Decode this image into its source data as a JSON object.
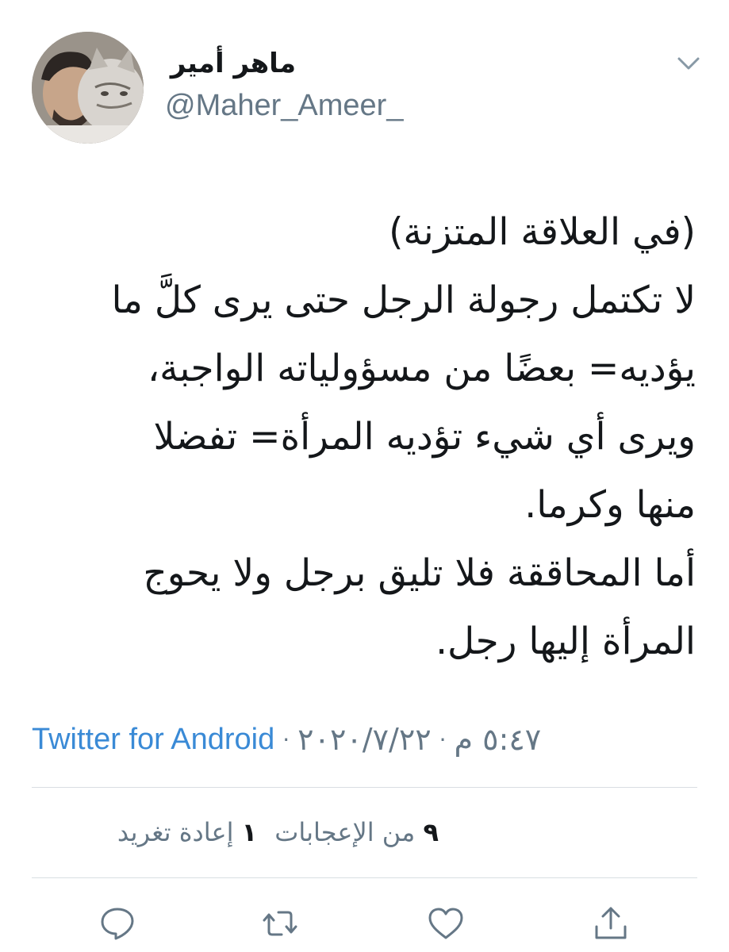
{
  "user": {
    "name": "ماهر أمير",
    "handle": "@Maher_Ameer_"
  },
  "tweet": {
    "lines": [
      "(في العلاقة المتزنة)",
      "لا تكتمل رجولة الرجل حتى يرى كلَّ ما",
      "يؤديه= بعضًا من مسؤولياته الواجبة،",
      "ويرى أي شيء تؤديه المرأة= تفضلا",
      "منها وكرما.",
      "أما المحاققة فلا تليق برجل ولا يحوج",
      "المرأة إليها رجل."
    ]
  },
  "meta": {
    "time": "٥:٤٧ م",
    "date": "٢٠٢٠/٧/٢٢",
    "source": "Twitter for Android",
    "separator": "·"
  },
  "stats": {
    "likes_count": "٩",
    "likes_label": "من الإعجابات",
    "retweets_count": "١",
    "retweets_label": "إعادة تغريد"
  },
  "colors": {
    "link": "#3a8ad6",
    "secondary_text": "#657786",
    "primary_text": "#14171a",
    "divider": "#d9dee2"
  },
  "icons": {
    "reply": "reply-icon",
    "retweet": "retweet-icon",
    "like": "heart-icon",
    "share": "share-icon",
    "menu": "chevron-down-icon"
  }
}
